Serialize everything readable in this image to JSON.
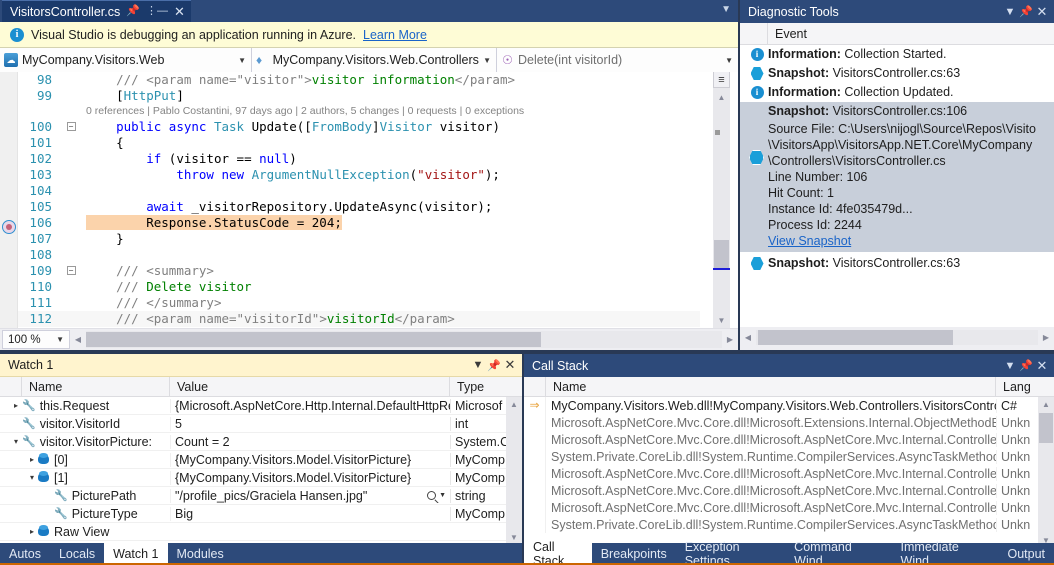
{
  "editor": {
    "tab": {
      "filename": "VisitorsController.cs",
      "pin_icon": "pin-icon",
      "close_icon": "close-icon"
    },
    "infobar": {
      "message": "Visual Studio is debugging an application running in Azure.",
      "link": "Learn More",
      "icon": "info-icon",
      "background": "#fefcd6"
    },
    "navbar": {
      "project": "MyCompany.Visitors.Web",
      "type": "MyCompany.Visitors.Web.Controllers.\\",
      "member": "Delete(int visitorId)"
    },
    "zoom_level": "100 %",
    "codelens": "0 references | Pablo Costantini, 97 days ago | 2 authors, 5 changes | 0 requests | 0 exceptions",
    "lines": [
      {
        "num": "98",
        "fold": "",
        "tokens": [
          {
            "t": "    ",
            "c": "pln"
          },
          {
            "t": "/// ",
            "c": "cgray"
          },
          {
            "t": "<param name=",
            "c": "cgray"
          },
          {
            "t": "\"visitor\"",
            "c": "cgray"
          },
          {
            "t": ">",
            "c": "cgray"
          },
          {
            "t": "visitor information",
            "c": "cmt"
          },
          {
            "t": "</param>",
            "c": "cgray"
          }
        ]
      },
      {
        "num": "99",
        "fold": "",
        "tokens": [
          {
            "t": "    ",
            "c": "pln"
          },
          {
            "t": "[",
            "c": "pln"
          },
          {
            "t": "HttpPut",
            "c": "typ"
          },
          {
            "t": "]",
            "c": "pln"
          }
        ]
      },
      {
        "num": "",
        "fold": "",
        "annotation": true
      },
      {
        "num": "100",
        "fold": "minus",
        "tokens": [
          {
            "t": "    ",
            "c": "pln"
          },
          {
            "t": "public",
            "c": "kw"
          },
          {
            "t": " ",
            "c": "pln"
          },
          {
            "t": "async",
            "c": "kw"
          },
          {
            "t": " ",
            "c": "pln"
          },
          {
            "t": "Task",
            "c": "typ"
          },
          {
            "t": " Update([",
            "c": "pln"
          },
          {
            "t": "FromBody",
            "c": "typ"
          },
          {
            "t": "]",
            "c": "pln"
          },
          {
            "t": "Visitor",
            "c": "typ"
          },
          {
            "t": " visitor)",
            "c": "pln"
          }
        ]
      },
      {
        "num": "101",
        "fold": "",
        "tokens": [
          {
            "t": "    {",
            "c": "pln"
          }
        ]
      },
      {
        "num": "102",
        "fold": "",
        "tokens": [
          {
            "t": "        ",
            "c": "pln"
          },
          {
            "t": "if",
            "c": "kw"
          },
          {
            "t": " (visitor == ",
            "c": "pln"
          },
          {
            "t": "null",
            "c": "kw"
          },
          {
            "t": ")",
            "c": "pln"
          }
        ]
      },
      {
        "num": "103",
        "fold": "",
        "tokens": [
          {
            "t": "            ",
            "c": "pln"
          },
          {
            "t": "throw",
            "c": "kw"
          },
          {
            "t": " ",
            "c": "pln"
          },
          {
            "t": "new",
            "c": "kw"
          },
          {
            "t": " ",
            "c": "pln"
          },
          {
            "t": "ArgumentNullException",
            "c": "typ"
          },
          {
            "t": "(",
            "c": "pln"
          },
          {
            "t": "\"visitor\"",
            "c": "str"
          },
          {
            "t": ");",
            "c": "pln"
          }
        ]
      },
      {
        "num": "104",
        "fold": "",
        "tokens": []
      },
      {
        "num": "105",
        "fold": "",
        "tokens": [
          {
            "t": "        ",
            "c": "pln"
          },
          {
            "t": "await",
            "c": "kw"
          },
          {
            "t": " _visitorRepository.UpdateAsync(visitor);",
            "c": "pln"
          }
        ]
      },
      {
        "num": "106",
        "fold": "",
        "highlight": "statement",
        "tokens": [
          {
            "t": "        ",
            "c": "pln"
          },
          {
            "t": "Response.StatusCode = 204;",
            "c": "pln"
          }
        ]
      },
      {
        "num": "107",
        "fold": "",
        "tokens": [
          {
            "t": "    }",
            "c": "pln"
          }
        ]
      },
      {
        "num": "108",
        "fold": "",
        "tokens": []
      },
      {
        "num": "109",
        "fold": "minus",
        "tokens": [
          {
            "t": "    ",
            "c": "pln"
          },
          {
            "t": "/// <summary>",
            "c": "cgray"
          }
        ]
      },
      {
        "num": "110",
        "fold": "",
        "tokens": [
          {
            "t": "    ",
            "c": "pln"
          },
          {
            "t": "/// ",
            "c": "cgray"
          },
          {
            "t": "Delete visitor",
            "c": "cmt"
          }
        ]
      },
      {
        "num": "111",
        "fold": "",
        "tokens": [
          {
            "t": "    ",
            "c": "pln"
          },
          {
            "t": "/// </summary>",
            "c": "cgray"
          }
        ]
      },
      {
        "num": "112",
        "fold": "",
        "highlight": "current",
        "tokens": [
          {
            "t": "    ",
            "c": "pln"
          },
          {
            "t": "/// <param name=",
            "c": "cgray"
          },
          {
            "t": "\"visitorId\"",
            "c": "cgray"
          },
          {
            "t": ">",
            "c": "cgray"
          },
          {
            "t": "visitorId",
            "c": "cmt"
          },
          {
            "t": "</param>",
            "c": "cgray"
          }
        ]
      }
    ]
  },
  "diagnostics": {
    "title": "Diagnostic Tools",
    "column_header": "Event",
    "events": [
      {
        "icon": "info-icon",
        "label": "Information:",
        "text": " Collection Started.",
        "selected": false
      },
      {
        "icon": "snapshot-icon",
        "label": "Snapshot:",
        "text": " VisitorsController.cs:63",
        "selected": false
      },
      {
        "icon": "info-icon",
        "label": "Information:",
        "text": " Collection Updated.",
        "selected": false
      }
    ],
    "selected_event": {
      "icon": "snapshot-icon",
      "label": "Snapshot:",
      "text": " VisitorsController.cs:106",
      "details": [
        "Source File: C:\\Users\\nijogl\\Source\\Repos\\Visito",
        "\\VisitorsApp\\VisitorsApp.NET.Core\\MyCompany",
        "\\Controllers\\VisitorsController.cs",
        "Line Number: 106",
        "Hit Count: 1",
        "Instance Id: 4fe035479d...",
        "Process Id: 2244"
      ],
      "link": "View Snapshot"
    },
    "last_event": {
      "icon": "snapshot-icon",
      "label": "Snapshot:",
      "text": " VisitorsController.cs:63"
    }
  },
  "watch": {
    "title": "Watch 1",
    "columns": [
      "Name",
      "Value",
      "Type"
    ],
    "rows": [
      {
        "indent": 0,
        "expander": "collapsed",
        "icon": "wrench-icon",
        "name": "this.Request",
        "value": "{Microsoft.AspNetCore.Http.Internal.DefaultHttpReque",
        "type": "Microsof"
      },
      {
        "indent": 0,
        "expander": "none",
        "icon": "wrench-icon",
        "name": "visitor.VisitorId",
        "value": "5",
        "type": "int"
      },
      {
        "indent": 0,
        "expander": "expanded",
        "icon": "wrench-icon",
        "name": "visitor.VisitorPicture:",
        "value": "Count = 2",
        "type": "System.C"
      },
      {
        "indent": 1,
        "expander": "collapsed",
        "icon": "bubble-icon",
        "name": "[0]",
        "value": "{MyCompany.Visitors.Model.VisitorPicture}",
        "type": "MyComp"
      },
      {
        "indent": 1,
        "expander": "expanded",
        "icon": "bubble-icon",
        "name": "[1]",
        "value": "{MyCompany.Visitors.Model.VisitorPicture}",
        "type": "MyComp"
      },
      {
        "indent": 2,
        "expander": "none",
        "icon": "wrench-icon",
        "name": "PicturePath",
        "value": "\"/profile_pics/Graciela Hansen.jpg\"",
        "type": "string",
        "magnifier": true
      },
      {
        "indent": 2,
        "expander": "none",
        "icon": "wrench-icon",
        "name": "PictureType",
        "value": "Big",
        "type": "MyComp"
      },
      {
        "indent": 1,
        "expander": "collapsed",
        "icon": "bubble-icon",
        "name": "Raw View",
        "value": "",
        "type": ""
      }
    ],
    "tabs": [
      {
        "label": "Autos",
        "active": false
      },
      {
        "label": "Locals",
        "active": false
      },
      {
        "label": "Watch 1",
        "active": true
      },
      {
        "label": "Modules",
        "active": false
      }
    ]
  },
  "callstack": {
    "title": "Call Stack",
    "columns": [
      "Name",
      "Lang"
    ],
    "rows": [
      {
        "current": true,
        "name": "MyCompany.Visitors.Web.dll!MyCompany.Visitors.Web.Controllers.VisitorsController.",
        "lang": "C#"
      },
      {
        "current": false,
        "name": "Microsoft.AspNetCore.Mvc.Core.dll!Microsoft.Extensions.Internal.ObjectMethodExecu",
        "lang": "Unkn"
      },
      {
        "current": false,
        "name": "Microsoft.AspNetCore.Mvc.Core.dll!Microsoft.AspNetCore.Mvc.Internal.ControllerAct",
        "lang": "Unkn"
      },
      {
        "current": false,
        "name": "System.Private.CoreLib.dll!System.Runtime.CompilerServices.AsyncTaskMethodBuilde",
        "lang": "Unkn"
      },
      {
        "current": false,
        "name": "Microsoft.AspNetCore.Mvc.Core.dll!Microsoft.AspNetCore.Mvc.Internal.ControllerAct",
        "lang": "Unkn"
      },
      {
        "current": false,
        "name": "Microsoft.AspNetCore.Mvc.Core.dll!Microsoft.AspNetCore.Mvc.Internal.ControllerAct",
        "lang": "Unkn"
      },
      {
        "current": false,
        "name": "Microsoft.AspNetCore.Mvc.Core.dll!Microsoft.AspNetCore.Mvc.Internal.ControllerAct",
        "lang": "Unkn"
      },
      {
        "current": false,
        "name": "System.Private.CoreLib.dll!System.Runtime.CompilerServices.AsyncTaskMethodBuilde",
        "lang": "Unkn"
      }
    ],
    "tabs": [
      {
        "label": "Call Stack",
        "active": true
      },
      {
        "label": "Breakpoints",
        "active": false
      },
      {
        "label": "Exception Settings",
        "active": false
      },
      {
        "label": "Command Wind...",
        "active": false
      },
      {
        "label": "Immediate Wind...",
        "active": false
      },
      {
        "label": "Output",
        "active": false
      }
    ]
  },
  "colors": {
    "titlebar": "#2d4a7a",
    "chrome": "#293955",
    "accent_orange": "#cc6600",
    "info_yellow": "#fefcd6",
    "statement_highlight": "#fbd3ab",
    "link_blue": "#1a64c8"
  }
}
